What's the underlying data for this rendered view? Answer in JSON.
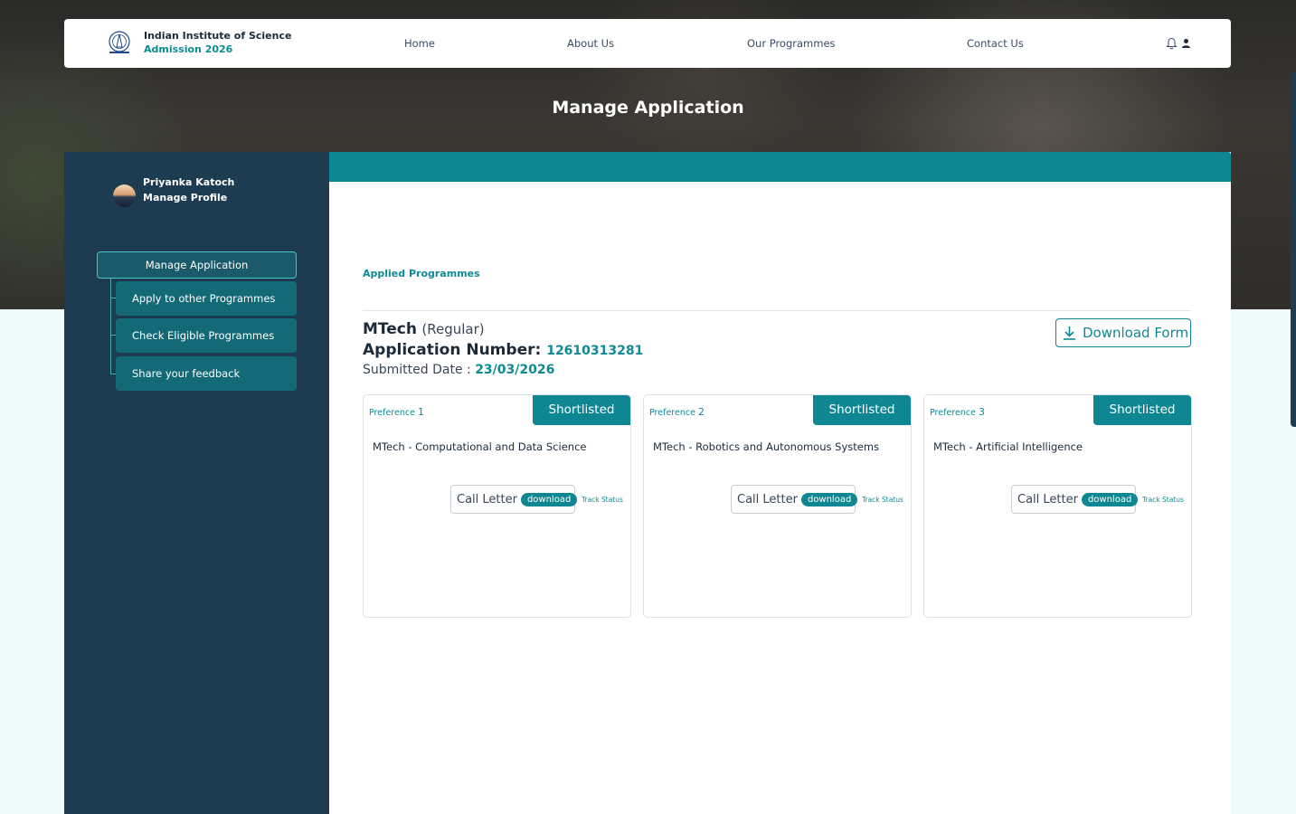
{
  "header": {
    "institute": "Indian Institute of Science",
    "admission": "Admission 2026",
    "nav": [
      "Home",
      "About Us",
      "Our Programmes",
      "Contact Us"
    ]
  },
  "page": {
    "title": "Manage Application"
  },
  "sidebar": {
    "user_name": "Priyanka Katoch",
    "manage_profile": "Manage Profile",
    "menu_main": "Manage Application",
    "menu_items": [
      "Apply to other Programmes",
      "Check Eligible Programmes",
      "Share your feedback"
    ]
  },
  "main": {
    "section_label": "Applied Programmes",
    "programme": "MTech",
    "mode": "(Regular)",
    "app_number_label": "Application Number:",
    "app_number": "12610313281",
    "submitted_label": "Submitted Date :",
    "submitted_date": "23/03/2026",
    "download_form": "Download Form"
  },
  "cards": [
    {
      "pref_label": "Preference",
      "pref_no": "1",
      "status": "Shortlisted",
      "programme": "MTech - Computational and Data Science",
      "call_letter": "Call Letter",
      "download": "download",
      "track": "Track Status"
    },
    {
      "pref_label": "Preference",
      "pref_no": "2",
      "status": "Shortlisted",
      "programme": "MTech - Robotics and Autonomous Systems",
      "call_letter": "Call Letter",
      "download": "download",
      "track": "Track Status"
    },
    {
      "pref_label": "Preference",
      "pref_no": "3",
      "status": "Shortlisted",
      "programme": "MTech - Artificial Intelligence",
      "call_letter": "Call Letter",
      "download": "download",
      "track": "Track Status"
    }
  ],
  "colors": {
    "accent": "#0f8792",
    "sidebar": "#1d3c52",
    "menu_sub": "#136a76"
  },
  "icons": [
    "iisc-logo",
    "bell-icon",
    "user-icon",
    "download-icon"
  ]
}
